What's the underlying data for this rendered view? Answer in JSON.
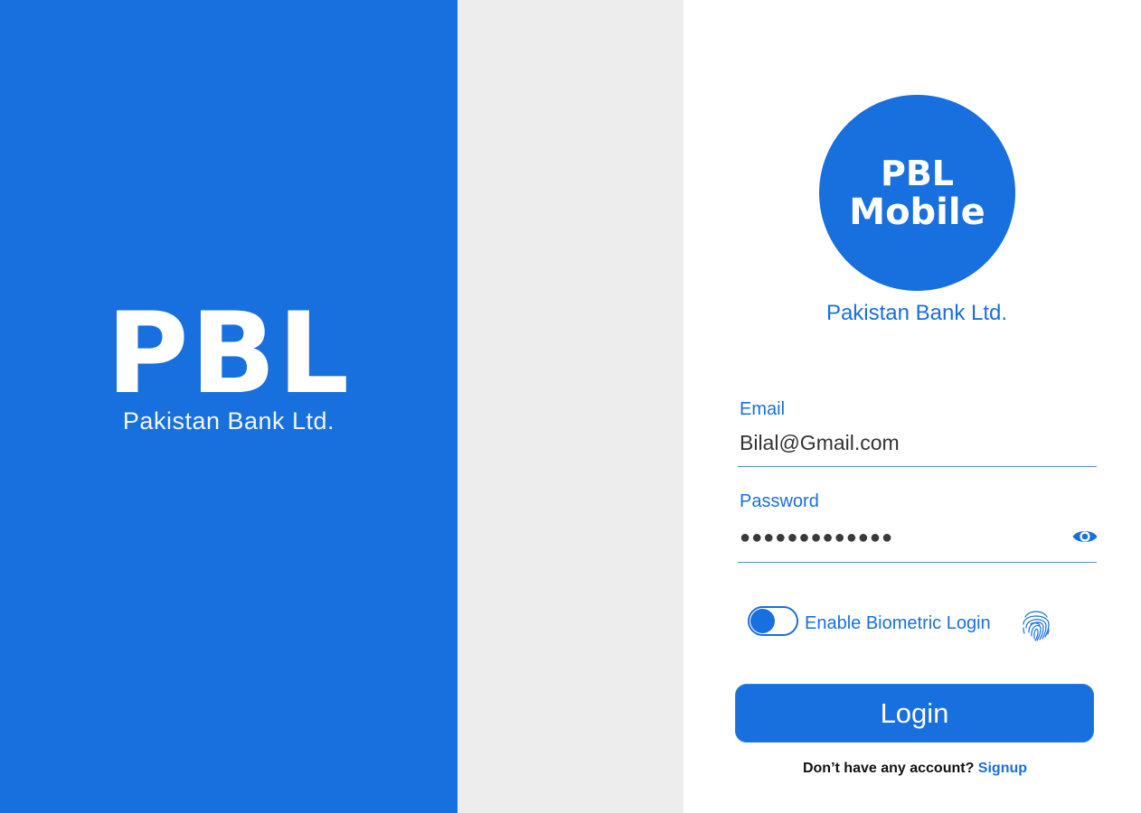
{
  "splash": {
    "title": "PBL",
    "subtitle": "Pakistan Bank Ltd."
  },
  "logo": {
    "line1": "PBL",
    "line2": "Mobile"
  },
  "bank_name": "Pakistan Bank Ltd.",
  "form": {
    "email": {
      "label": "Email",
      "value": "Bilal@Gmail.com"
    },
    "password": {
      "label": "Password",
      "value_masked": "●●●●●●●●●●●●●",
      "visibility_icon": "eye-icon"
    },
    "biometric": {
      "label": "Enable Biometric Login",
      "enabled": true,
      "icon": "fingerprint-icon"
    },
    "login_button": "Login",
    "signup_prompt": "Don’t have any account?",
    "signup_link": "Signup"
  },
  "colors": {
    "brand_blue": "#186fde",
    "gutter_gray": "#ededed",
    "text_dark": "#333333"
  }
}
